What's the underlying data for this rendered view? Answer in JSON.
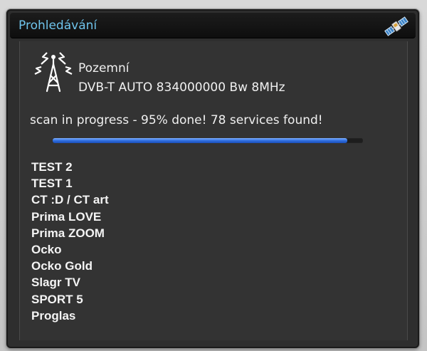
{
  "window": {
    "title": "Prohledávání"
  },
  "icons": {
    "title_icon": "satellite-icon",
    "source_icon": "antenna-tower-icon"
  },
  "tuner": {
    "source": "Pozemní",
    "transponder": "DVB-T AUTO 834000000 Bw 8MHz"
  },
  "scan": {
    "status_text": "scan in progress - 95% done! 78 services found!",
    "progress_percent": 95
  },
  "services": [
    "TEST 2",
    "TEST 1",
    "CT :D / CT art",
    "Prima LOVE",
    "Prima ZOOM",
    "Ocko",
    "Ocko Gold",
    "Slagr TV",
    "SPORT 5",
    "Proglas"
  ],
  "colors": {
    "title": "#6fc4ec",
    "progress": "#2f6fe0",
    "background": "#333333"
  }
}
